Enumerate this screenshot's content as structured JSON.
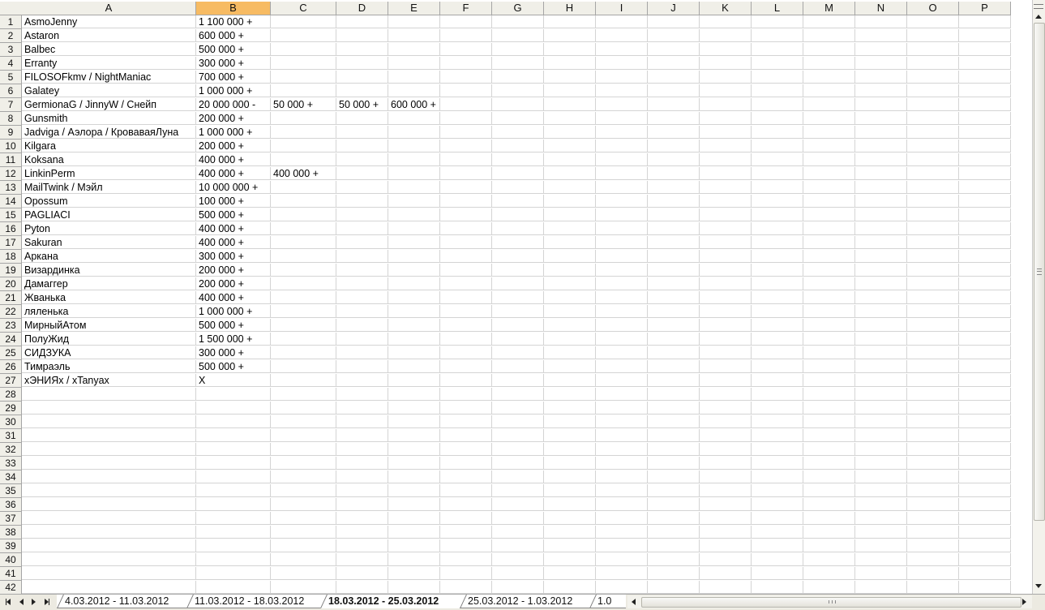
{
  "colors": {
    "header_bg": "#f0efe8",
    "active_header_bg": "#f7bb63",
    "gridline": "#d4d4d4",
    "header_border": "#a5a5a5"
  },
  "columns": [
    "A",
    "B",
    "C",
    "D",
    "E",
    "F",
    "G",
    "H",
    "I",
    "J",
    "K",
    "L",
    "M",
    "N",
    "O",
    "P"
  ],
  "active_column": "B",
  "rows": [
    {
      "n": "1",
      "cells": [
        "AsmoJenny",
        "1 100 000 +",
        "",
        "",
        ""
      ]
    },
    {
      "n": "2",
      "cells": [
        "Astaron",
        "600 000 +",
        "",
        "",
        ""
      ]
    },
    {
      "n": "3",
      "cells": [
        "Balbec",
        "500 000 +",
        "",
        "",
        ""
      ]
    },
    {
      "n": "4",
      "cells": [
        "Erranty",
        "300 000 +",
        "",
        "",
        ""
      ]
    },
    {
      "n": "5",
      "cells": [
        "FILOSOFkmv / NightManiac",
        "700 000 +",
        "",
        "",
        ""
      ]
    },
    {
      "n": "6",
      "cells": [
        "Galatey",
        "1 000 000 +",
        "",
        "",
        ""
      ]
    },
    {
      "n": "7",
      "cells": [
        "GermionaG / JinnyW / Снейп",
        "20 000 000 -",
        "50 000 +",
        "50 000 +",
        "600 000 +"
      ]
    },
    {
      "n": "8",
      "cells": [
        "Gunsmith",
        "200 000 +",
        "",
        "",
        ""
      ]
    },
    {
      "n": "9",
      "cells": [
        "Jadviga / Аэлора / КроваваяЛуна",
        "1 000 000 +",
        "",
        "",
        ""
      ]
    },
    {
      "n": "10",
      "cells": [
        "Kilgara",
        "200 000 +",
        "",
        "",
        ""
      ]
    },
    {
      "n": "11",
      "cells": [
        "Koksana",
        "400 000 +",
        "",
        "",
        ""
      ]
    },
    {
      "n": "12",
      "cells": [
        "LinkinPerm",
        "400 000 +",
        "400 000 +",
        "",
        ""
      ]
    },
    {
      "n": "13",
      "cells": [
        "MailTwink / Мэйл",
        "10 000 000 +",
        "",
        "",
        ""
      ]
    },
    {
      "n": "14",
      "cells": [
        "Opossum",
        "100 000 +",
        "",
        "",
        ""
      ]
    },
    {
      "n": "15",
      "cells": [
        "PAGLIACI",
        "500 000 +",
        "",
        "",
        ""
      ]
    },
    {
      "n": "16",
      "cells": [
        "Pyton",
        "400 000 +",
        "",
        "",
        ""
      ]
    },
    {
      "n": "17",
      "cells": [
        "Sakuran",
        "400 000 +",
        "",
        "",
        ""
      ]
    },
    {
      "n": "18",
      "cells": [
        "Аркана",
        "300 000 +",
        "",
        "",
        ""
      ]
    },
    {
      "n": "19",
      "cells": [
        "Визардинка",
        "200 000 +",
        "",
        "",
        ""
      ]
    },
    {
      "n": "20",
      "cells": [
        "Дамаггер",
        "200 000 +",
        "",
        "",
        ""
      ]
    },
    {
      "n": "21",
      "cells": [
        "Жванька",
        "400 000 +",
        "",
        "",
        ""
      ]
    },
    {
      "n": "22",
      "cells": [
        "ляленька",
        "1 000 000 +",
        "",
        "",
        ""
      ]
    },
    {
      "n": "23",
      "cells": [
        "МирныйАтом",
        "500 000 +",
        "",
        "",
        ""
      ]
    },
    {
      "n": "24",
      "cells": [
        "ПолуЖид",
        "1 500 000 +",
        "",
        "",
        ""
      ]
    },
    {
      "n": "25",
      "cells": [
        "СИДЗУКА",
        "300 000 +",
        "",
        "",
        ""
      ]
    },
    {
      "n": "26",
      "cells": [
        "Тимраэль",
        "500 000 +",
        "",
        "",
        ""
      ]
    },
    {
      "n": "27",
      "cells": [
        "хЭНИЯх / хTanyaх",
        "X",
        "",
        "",
        ""
      ]
    },
    {
      "n": "28",
      "cells": [
        "",
        "",
        "",
        "",
        ""
      ]
    },
    {
      "n": "29",
      "cells": [
        "",
        "",
        "",
        "",
        ""
      ]
    },
    {
      "n": "30",
      "cells": [
        "",
        "",
        "",
        "",
        ""
      ]
    },
    {
      "n": "31",
      "cells": [
        "",
        "",
        "",
        "",
        ""
      ]
    },
    {
      "n": "32",
      "cells": [
        "",
        "",
        "",
        "",
        ""
      ]
    },
    {
      "n": "33",
      "cells": [
        "",
        "",
        "",
        "",
        ""
      ]
    },
    {
      "n": "34",
      "cells": [
        "",
        "",
        "",
        "",
        ""
      ]
    },
    {
      "n": "35",
      "cells": [
        "",
        "",
        "",
        "",
        ""
      ]
    },
    {
      "n": "36",
      "cells": [
        "",
        "",
        "",
        "",
        ""
      ]
    },
    {
      "n": "37",
      "cells": [
        "",
        "",
        "",
        "",
        ""
      ]
    },
    {
      "n": "38",
      "cells": [
        "",
        "",
        "",
        "",
        ""
      ]
    },
    {
      "n": "39",
      "cells": [
        "",
        "",
        "",
        "",
        ""
      ]
    },
    {
      "n": "40",
      "cells": [
        "",
        "",
        "",
        "",
        ""
      ]
    },
    {
      "n": "41",
      "cells": [
        "",
        "",
        "",
        "",
        ""
      ]
    },
    {
      "n": "42",
      "cells": [
        "",
        "",
        "",
        "",
        ""
      ]
    }
  ],
  "tabs": [
    {
      "label": "4.03.2012 - 11.03.2012",
      "active": false
    },
    {
      "label": "11.03.2012 - 18.03.2012",
      "active": false
    },
    {
      "label": "18.03.2012 - 25.03.2012",
      "active": true
    },
    {
      "label": "25.03.2012 - 1.03.2012",
      "active": false
    },
    {
      "label": "1.0",
      "active": false
    }
  ],
  "icons": {
    "first_sheet": "first-sheet-icon",
    "prev_sheet": "prev-sheet-icon",
    "next_sheet": "next-sheet-icon",
    "last_sheet": "last-sheet-icon"
  }
}
